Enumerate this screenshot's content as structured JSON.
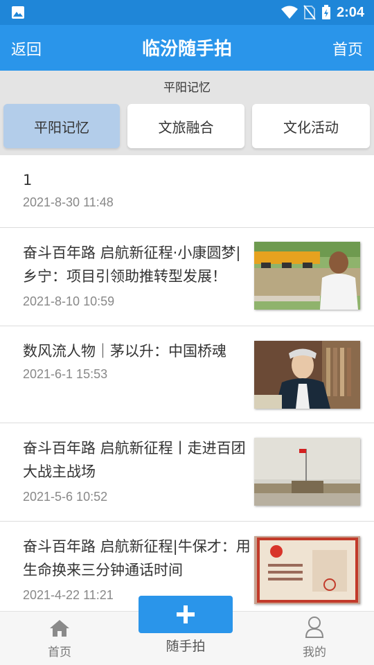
{
  "status_bar": {
    "time": "2:04",
    "icons": [
      "gallery-icon",
      "wifi-icon",
      "no-sim-icon",
      "battery-charging-icon"
    ]
  },
  "app_bar": {
    "back_label": "返回",
    "title": "临汾随手拍",
    "home_label": "首页"
  },
  "section": {
    "title": "平阳记忆",
    "tabs": [
      {
        "label": "平阳记忆",
        "active": true
      },
      {
        "label": "文旅融合",
        "active": false
      },
      {
        "label": "文化活动",
        "active": false
      }
    ]
  },
  "news": [
    {
      "title": "1",
      "date": "2021-8-30 11:48",
      "has_image": false
    },
    {
      "title": "奋斗百年路 启航新征程·小康圆梦|乡宁：项目引领助推转型发展！",
      "date": "2021-8-10 10:59",
      "has_image": true,
      "image": "construction-interview-thumb"
    },
    {
      "title": "数风流人物｜茅以升：中国桥魂",
      "date": "2021-6-1 15:53",
      "has_image": true,
      "image": "portrait-reading-thumb"
    },
    {
      "title": "奋斗百年路 启航新征程丨走进百团大战主战场",
      "date": "2021-5-6 10:52",
      "has_image": true,
      "image": "memorial-hall-flag-thumb"
    },
    {
      "title": "奋斗百年路 启航新征程|牛保才：用生命换来三分钟通话时间",
      "date": "2021-4-22 11:21",
      "has_image": true,
      "image": "certificate-thumb"
    }
  ],
  "bottom_nav": {
    "home_label": "首页",
    "capture_label": "随手拍",
    "mine_label": "我的"
  },
  "colors": {
    "status_bar": "#1f86d8",
    "app_bar": "#2a95ea",
    "active_tab": "#b3cdea",
    "section_bg": "#e4e4e4"
  }
}
